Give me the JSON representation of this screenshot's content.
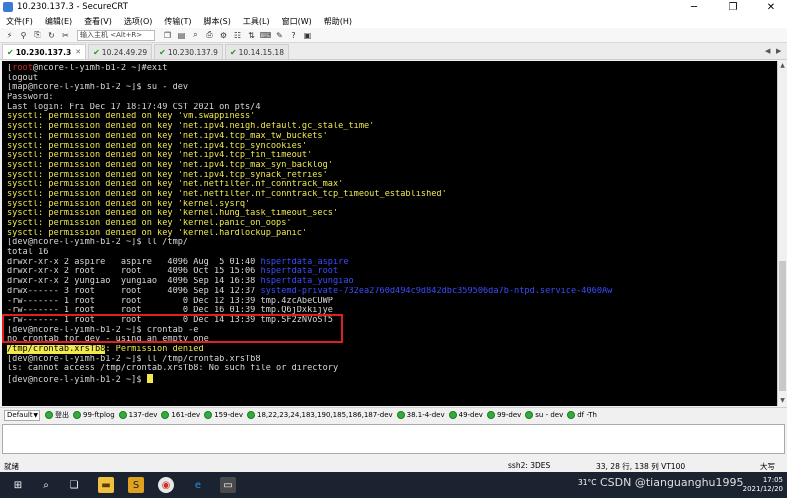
{
  "window": {
    "title": "10.230.137.3 - SecureCRT",
    "minimize": "─",
    "maximize": "❐",
    "close": "✕"
  },
  "menu": [
    "文件(F)",
    "编辑(E)",
    "查看(V)",
    "选项(O)",
    "传输(T)",
    "脚本(S)",
    "工具(L)",
    "窗口(W)",
    "帮助(H)"
  ],
  "toolbar": {
    "quick_connect": "输入主机 <Alt+R>"
  },
  "tabs": [
    {
      "label": "10.230.137.3",
      "active": true
    },
    {
      "label": "10.24.49.29",
      "active": false
    },
    {
      "label": "10.230.137.9",
      "active": false
    },
    {
      "label": "10.14.15.18",
      "active": false
    }
  ],
  "terminal": {
    "lines": [
      [
        {
          "t": "[",
          "c": "white"
        },
        {
          "t": "root",
          "c": "red"
        },
        {
          "t": "@ncore-l-yimh-b1-2 ~]#exit",
          "c": "white"
        }
      ],
      [
        {
          "t": "logout",
          "c": "white"
        }
      ],
      [
        {
          "t": "[map@ncore-l-yimh-b1-2 ~]$ su - dev",
          "c": "white"
        }
      ],
      [
        {
          "t": "Password:",
          "c": "white"
        }
      ],
      [
        {
          "t": "Last login: Fri Dec 17 18:17:49 CST 2021 on pts/4",
          "c": "white"
        }
      ],
      [
        {
          "t": "sysctl: permission denied on key 'vm.swappiness'",
          "c": "yellow"
        }
      ],
      [
        {
          "t": "sysctl: permission denied on key 'net.ipv4.neigh.default.gc_stale_time'",
          "c": "yellow"
        }
      ],
      [
        {
          "t": "sysctl: permission denied on key 'net.ipv4.tcp_max_tw_buckets'",
          "c": "yellow"
        }
      ],
      [
        {
          "t": "sysctl: permission denied on key 'net.ipv4.tcp_syncookies'",
          "c": "yellow"
        }
      ],
      [
        {
          "t": "sysctl: permission denied on key 'net.ipv4.tcp_fin_timeout'",
          "c": "yellow"
        }
      ],
      [
        {
          "t": "sysctl: permission denied on key 'net.ipv4.tcp_max_syn_backlog'",
          "c": "yellow"
        }
      ],
      [
        {
          "t": "sysctl: permission denied on key 'net.ipv4.tcp_synack_retries'",
          "c": "yellow"
        }
      ],
      [
        {
          "t": "sysctl: permission denied on key 'net.netfilter.nf_conntrack_max'",
          "c": "yellow"
        }
      ],
      [
        {
          "t": "sysctl: permission denied on key 'net.netfilter.nf_conntrack_tcp_timeout_established'",
          "c": "yellow"
        }
      ],
      [
        {
          "t": "sysctl: permission denied on key 'kernel.sysrq'",
          "c": "yellow"
        }
      ],
      [
        {
          "t": "sysctl: permission denied on key 'kernel.hung_task_timeout_secs'",
          "c": "yellow"
        }
      ],
      [
        {
          "t": "sysctl: permission denied on key 'kernel.panic_on_oops'",
          "c": "yellow"
        }
      ],
      [
        {
          "t": "sysctl: permission denied on key 'kernel.hardlockup_panic'",
          "c": "yellow"
        }
      ],
      [
        {
          "t": "[dev@ncore-l-yimh-b1-2 ~]$ ll /tmp/",
          "c": "white"
        }
      ],
      [
        {
          "t": "total 16",
          "c": "white"
        }
      ],
      [
        {
          "t": "drwxr-xr-x 2 aspire   aspire   4096 Aug  5 01:40 ",
          "c": "white"
        },
        {
          "t": "hsperfdata_aspire",
          "c": "blue"
        }
      ],
      [
        {
          "t": "drwxr-xr-x 2 root     root     4096 Oct 15 15:06 ",
          "c": "white"
        },
        {
          "t": "hsperfdata_root",
          "c": "blue"
        }
      ],
      [
        {
          "t": "drwxr-xr-x 2 yungiao  yungiao  4096 Sep 14 16:38 ",
          "c": "white"
        },
        {
          "t": "hsperfdata_yungiao",
          "c": "blue"
        }
      ],
      [
        {
          "t": "drwx------ 3 root     root     4096 Sep 14 12:37 ",
          "c": "white"
        },
        {
          "t": "systemd-private-732ea2760d494c9d842dbc359506da7b-ntpd.service-4060Aw",
          "c": "blue"
        }
      ],
      [
        {
          "t": "-rw------- 1 root     root        0 Dec 12 13:39 tmp.4zcAbeCUWP",
          "c": "white"
        }
      ],
      [
        {
          "t": "-rw------- 1 root     root        0 Dec 16 01:39 tmp.Q6jDxkijye",
          "c": "white"
        }
      ],
      [
        {
          "t": "-rw------- 1 root     root        0 Dec 14 13:39 tmp.SF2zNVoST5",
          "c": "white"
        }
      ],
      [
        {
          "t": "[dev@ncore-l-yimh-b1-2 ~]$ crontab -e",
          "c": "white"
        }
      ],
      [
        {
          "t": "no crontab for dev - using an empty one",
          "c": "white"
        }
      ],
      [
        {
          "t": "/tmp/crontab.xrsTb8",
          "c": "hl"
        },
        {
          "t": ": Permission denied",
          "c": "yellow"
        }
      ],
      [
        {
          "t": "[dev@ncore-l-yimh-b1-2 ~]$ ll /tmp/crontab.xrsTb8",
          "c": "white"
        }
      ],
      [
        {
          "t": "ls: cannot access /tmp/crontab.xrsTb8: No such file or directory",
          "c": "white"
        }
      ],
      [
        {
          "t": "[dev@ncore-l-yimh-b1-2 ~]$ ",
          "c": "white"
        }
      ]
    ]
  },
  "button_bar": {
    "selector": "Default",
    "items": [
      "登出",
      "99-ftplog",
      "137-dev",
      "161-dev",
      "159-dev",
      "18,22,23,24,183,190,185,186,187-dev",
      "38.1-4-dev",
      "49-dev",
      "99-dev",
      "su - dev",
      "df -Th"
    ]
  },
  "status": {
    "left": "就绪",
    "protocol": "ssh2: 3DES",
    "position": "33,   28  行, 138 列 VT100",
    "caps": "大写"
  },
  "taskbar": {
    "weather": "31°C",
    "clock_time": "17:05",
    "clock_date": "2021/12/20"
  },
  "watermark": "CSDN @tianguanghu1995"
}
